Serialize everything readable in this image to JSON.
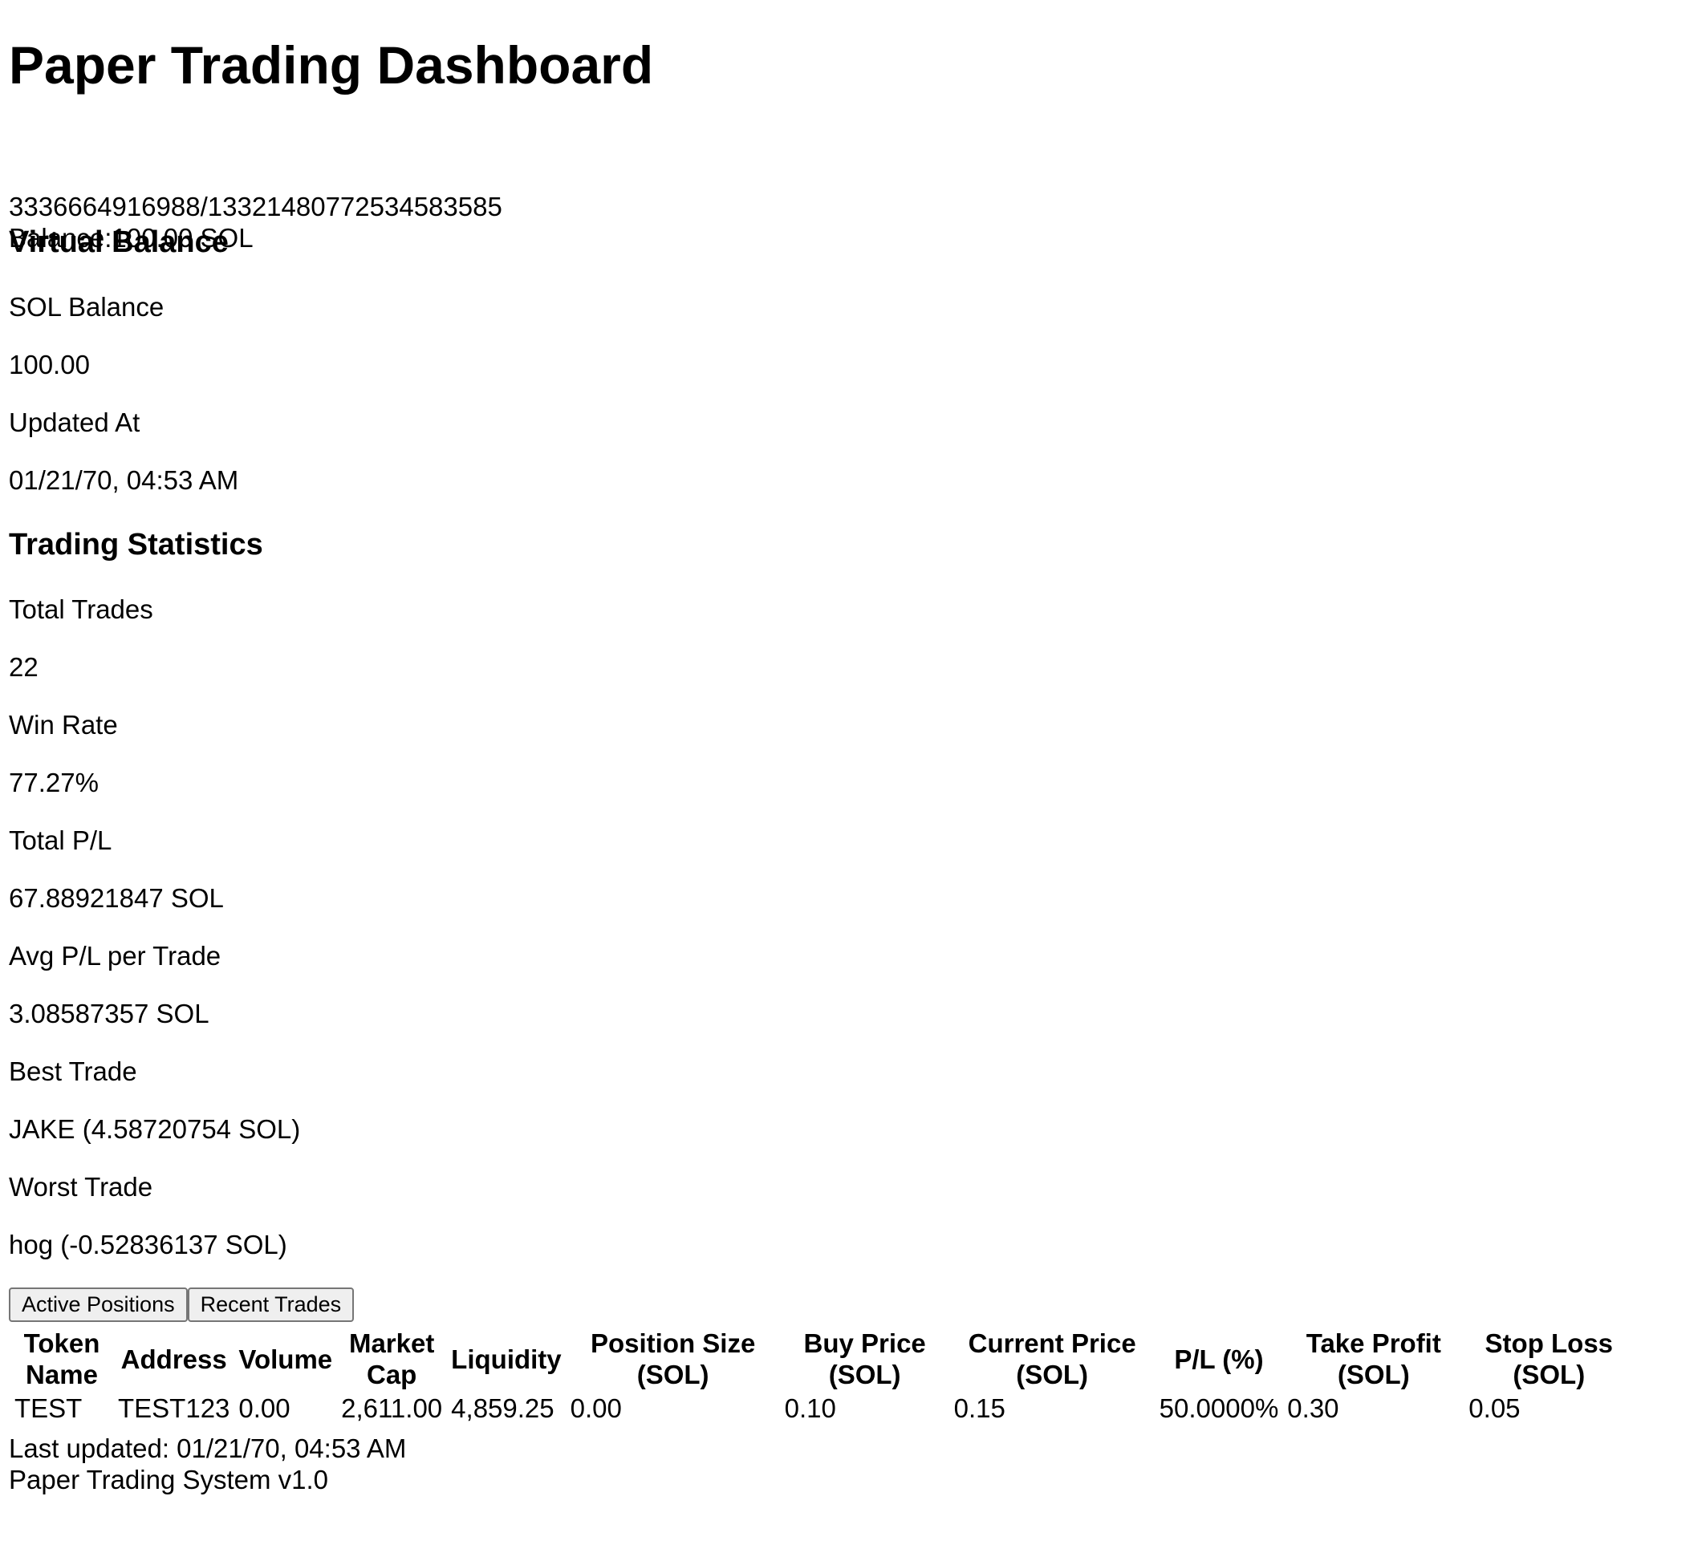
{
  "page": {
    "title": "Paper Trading Dashboard"
  },
  "account": {
    "id": "3336664916988/1332148077253458358​5",
    "balance_text": "Balance:100.00 SOL"
  },
  "virtual_balance": {
    "title": "Virtual Balance",
    "sol_balance_label": "SOL Balance",
    "sol_balance_value": "100.00",
    "updated_at_label": "Updated At",
    "updated_at_value": "01/21/70, 04:53 AM"
  },
  "statistics": {
    "title": "Trading Statistics",
    "total_trades_label": "Total Trades",
    "total_trades_value": "22",
    "win_rate_label": "Win Rate",
    "win_rate_value": "77.27%",
    "total_pl_label": "Total P/L",
    "total_pl_value": "67.88921847 SOL",
    "avg_pl_label": "Avg P/L per Trade",
    "avg_pl_value": "3.08587357 SOL",
    "best_trade_label": "Best Trade",
    "best_trade_value": "JAKE (4.58720754 SOL)",
    "worst_trade_label": "Worst Trade",
    "worst_trade_value": "hog (-0.52836137 SOL)"
  },
  "tabs": {
    "active_positions": "Active Positions",
    "recent_trades": "Recent Trades"
  },
  "positions_table": {
    "headers": {
      "token_name": "Token Name",
      "address": "Address",
      "volume": "Volume",
      "market_cap": "Market Cap",
      "liquidity": "Liquidity",
      "position_size": "Position Size (SOL)",
      "buy_price": "Buy Price (SOL)",
      "current_price": "Current Price (SOL)",
      "pl_pct": "P/L (%)",
      "take_profit": "Take Profit (SOL)",
      "stop_loss": "Stop Loss (SOL)"
    },
    "rows": [
      {
        "token_name": "TEST",
        "address": "TEST123",
        "volume": "0.00",
        "market_cap": "2,611.00",
        "liquidity": "4,859.25",
        "position_size": "0.00",
        "buy_price": "0.10",
        "current_price": "0.15",
        "pl_pct": "50.0000%",
        "take_profit": "0.30",
        "stop_loss": "0.05"
      }
    ]
  },
  "footer": {
    "last_updated": "Last updated: 01/21/70, 04:53 AM",
    "version": "Paper Trading System v1.0"
  }
}
